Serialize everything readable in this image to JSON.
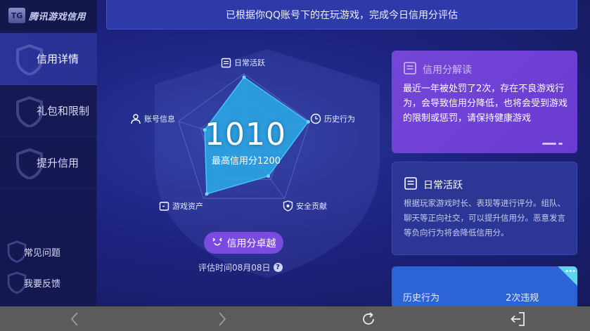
{
  "app": {
    "logo_text": "腾讯游戏信用",
    "logo_mark": "TG"
  },
  "sidebar": {
    "items": [
      {
        "label": "信用详情",
        "active": true
      },
      {
        "label": "礼包和限制",
        "active": false
      },
      {
        "label": "提升信用",
        "active": false
      }
    ],
    "bottom_items": [
      {
        "label": "常见问题"
      },
      {
        "label": "我要反馈"
      }
    ]
  },
  "banner": {
    "text": "已根据你QQ账号下的在玩游戏，完成今日信用分评估"
  },
  "radar": {
    "axes": [
      {
        "label": "日常活跃",
        "icon": "document-icon",
        "value": 0.95
      },
      {
        "label": "历史行为",
        "icon": "clock-icon",
        "value": 0.98
      },
      {
        "label": "安全贡献",
        "icon": "shield-icon",
        "value": 0.6
      },
      {
        "label": "游戏资产",
        "icon": "wallet-icon",
        "value": 0.92
      },
      {
        "label": "账号信息",
        "icon": "user-icon",
        "value": 0.6
      }
    ],
    "score": "1010",
    "max_label": "最高信用分1200",
    "rating_label": "信用分卓越",
    "eval_time": "评估时间08月08日",
    "help_glyph": "?"
  },
  "cards": {
    "interpretation": {
      "title": "信用分解读",
      "body": "最近一年被处罚了2次，存在不良游戏行为，会导致信用分降低，也将会受到游戏的限制或惩罚，请保持健康游戏"
    },
    "daily": {
      "title": "日常活跃",
      "body": "根据玩家游戏时长、表现等进行评分。组队、聊天等正向社交，可以提升信用分。恶意发言等负向行为将会降低信用分。"
    },
    "history": {
      "label": "历史行为",
      "value": "2次违规",
      "corner_glyph": "•••"
    }
  },
  "colors": {
    "accent_purple": "#7446d8",
    "radar_fill": "#2ba8e6",
    "bg": "#1d2380"
  }
}
